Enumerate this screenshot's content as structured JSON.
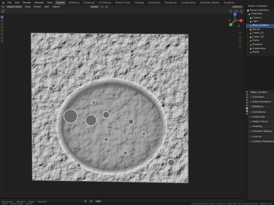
{
  "top_menu": {
    "items": [
      "File",
      "Edit",
      "Render",
      "Window",
      "Help"
    ],
    "workspaces": [
      "Layout",
      "Modeling",
      "Sculpting",
      "UV Editing",
      "Texture Paint",
      "Shading",
      "Animation",
      "Rendering",
      "Compositing",
      "Geometry Nodes",
      "Scripting"
    ],
    "active_workspace": "Layout",
    "scene": "Scene",
    "view_layer": "ViewLayer"
  },
  "viewport_header": {
    "mode": "Object Mode",
    "menus": [
      "View",
      "Select",
      "Add",
      "Object"
    ],
    "transform": "Global",
    "options": "Options"
  },
  "outliner": {
    "title": "Scene Collection",
    "rows": [
      {
        "label": "Scene Collection",
        "color": "#cccccc"
      },
      {
        "label": "Collection",
        "color": "#cccccc"
      },
      {
        "label": "Camera",
        "color": "#9ca0e0"
      },
      {
        "label": "Light",
        "color": "#e0c070"
      },
      {
        "label": "Moon_Surface",
        "color": "#f0a040",
        "selected": true
      },
      {
        "label": "Terrain",
        "color": "#f0a040"
      },
      {
        "label": "Crater_01",
        "color": "#f0a040"
      },
      {
        "label": "Crater_02",
        "color": "#f0a040"
      },
      {
        "label": "Rocks",
        "color": "#f0a040"
      },
      {
        "label": "Displace",
        "color": "#7ab0e0"
      },
      {
        "label": "Subdivision",
        "color": "#7ab0e0"
      },
      {
        "label": "World",
        "color": "#cc6666"
      }
    ]
  },
  "properties": {
    "object_name": "Moon_Surface",
    "sections": [
      "Transform",
      "Delta Transform",
      "Relations",
      "Collections",
      "Instancing",
      "Motion Paths",
      "Visibility",
      "Viewport Display",
      "Line Art",
      "Custom Properties"
    ]
  },
  "timeline": {
    "playback": "Playback",
    "keying": "Keying",
    "view": "View",
    "marker": "Marker",
    "frame": "1",
    "start": "1",
    "end": "250"
  },
  "status_bar": {
    "left": "Select",
    "middle": "Rotate View",
    "right": "Object",
    "stats": "Scene Collection | Moon_Surface | Verts 262,144 | Faces 261,121 | Objects 1/3"
  },
  "colors": {
    "selection": "#334d80",
    "gizmo_x": "#e04848",
    "gizmo_y": "#6ab03c",
    "gizmo_z": "#3c7ed8"
  }
}
